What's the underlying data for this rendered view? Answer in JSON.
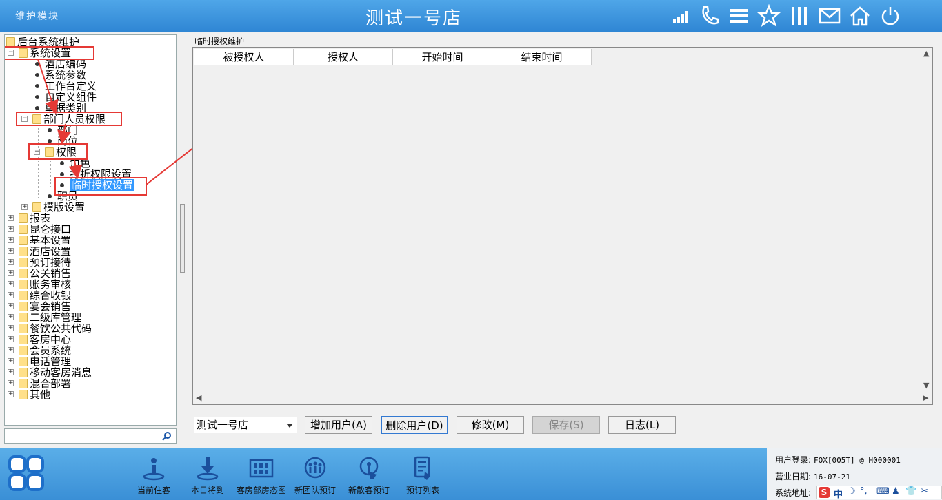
{
  "header": {
    "module_title": "维护模块",
    "store_name": "测试一号店",
    "icons": [
      "signal-icon",
      "phone-icon",
      "menu-icon",
      "star-icon",
      "columns-icon",
      "mail-icon",
      "home-icon",
      "power-icon"
    ]
  },
  "tree": {
    "root": "后台系统维护",
    "system_settings": "系统设置",
    "hotel_code": "酒店编码",
    "system_params": "系统参数",
    "workbench_def": "工作台定义",
    "custom_component": "自定义组件",
    "document_types": "单据类别",
    "dept_permissions": "部门人员权限",
    "department": "部门",
    "position": "岗位",
    "permissions": "权限",
    "role": "角色",
    "discount_perm": "打折权限设置",
    "temp_auth": "临时授权设置",
    "staff": "职员",
    "template_settings": "模版设置",
    "top_nodes": [
      "报表",
      "昆仑接口",
      "基本设置",
      "酒店设置",
      "预订接待",
      "公关销售",
      "账务审核",
      "综合收银",
      "宴会销售",
      "二级库管理",
      "餐饮公共代码",
      "客房中心",
      "会员系统",
      "电话管理",
      "移动客房消息",
      "混合部署",
      "其他"
    ]
  },
  "panel": {
    "title": "临时授权维护",
    "columns": [
      "被授权人",
      "授权人",
      "开始时间",
      "结束时间"
    ]
  },
  "controls": {
    "store_select": "测试一号店",
    "add_user": "增加用户(A)",
    "delete_user": "删除用户(D)",
    "modify": "修改(M)",
    "save": "保存(S)",
    "log": "日志(L)"
  },
  "footer": {
    "buttons": [
      "当前住客",
      "本日将到",
      "客房部房态图",
      "新团队预订",
      "新散客预订",
      "预订列表"
    ],
    "user_label": "用户登录:",
    "user_value": "FOX[005T] @ H000001",
    "date_label": "营业日期:",
    "date_value": "16-07-21",
    "addr_label": "系统地址:",
    "ime_text": "中"
  }
}
